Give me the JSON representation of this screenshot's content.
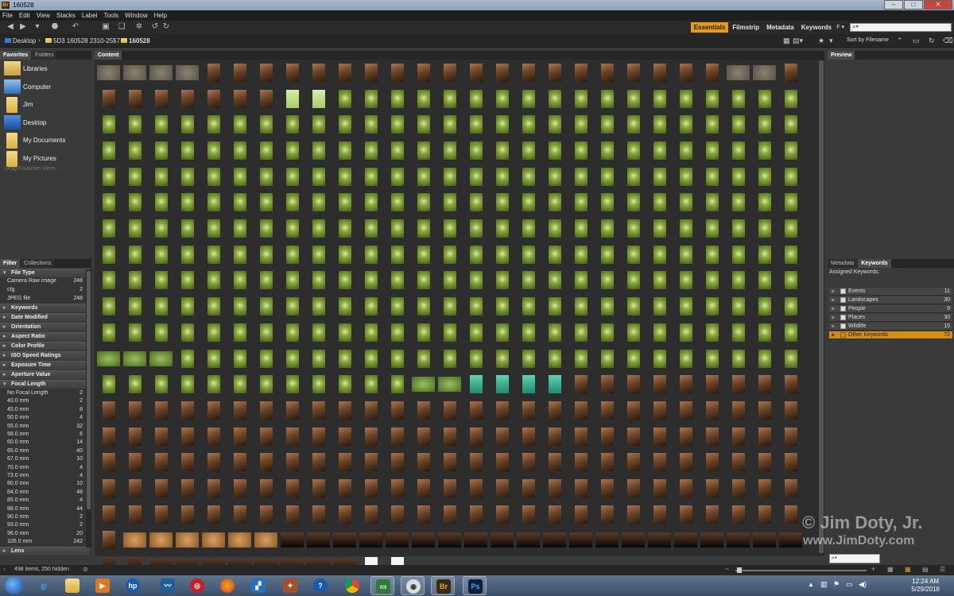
{
  "window": {
    "title": "160528",
    "app_icon": "Br"
  },
  "menu": [
    "File",
    "Edit",
    "View",
    "Stacks",
    "Label",
    "Tools",
    "Window",
    "Help"
  ],
  "workspaces": [
    "Essentials",
    "Filmstrip",
    "Metadata",
    "Keywords"
  ],
  "active_workspace": "Essentials",
  "breadcrumb": [
    "Desktop",
    "5D3 160528 2310-2557",
    "160528"
  ],
  "sort_label": "Sort by Filename",
  "tabs": {
    "favorites": "Favorites",
    "folders": "Folders",
    "content": "Content",
    "preview": "Preview",
    "filter": "Filter",
    "collections": "Collections",
    "metadata": "Metadata",
    "keywords": "Keywords"
  },
  "favorites": [
    "Libraries",
    "Computer",
    "Jim",
    "Desktop",
    "My Documents",
    "My Pictures"
  ],
  "favorites_hint": "Drag Favorites Here...",
  "filter": {
    "file_type_header": "File Type",
    "file_types": [
      {
        "label": "Camera Raw image",
        "count": "248"
      },
      {
        "label": "ctg",
        "count": "2"
      },
      {
        "label": "JPEG file",
        "count": "248"
      }
    ],
    "headers": [
      "Keywords",
      "Date Modified",
      "Orientation",
      "Aspect Ratio",
      "Color Profile",
      "ISO Speed Ratings",
      "Exposure Time",
      "Aperture Value"
    ],
    "focal_header": "Focal Length",
    "focal_lengths": [
      {
        "label": "No Focal Length",
        "count": "2"
      },
      {
        "label": "40.0 mm",
        "count": "2"
      },
      {
        "label": "45.0 mm",
        "count": "8"
      },
      {
        "label": "50.0 mm",
        "count": "4"
      },
      {
        "label": "55.0 mm",
        "count": "32"
      },
      {
        "label": "58.0 mm",
        "count": "6"
      },
      {
        "label": "60.0 mm",
        "count": "14"
      },
      {
        "label": "65.0 mm",
        "count": "40"
      },
      {
        "label": "67.0 mm",
        "count": "10"
      },
      {
        "label": "70.0 mm",
        "count": "4"
      },
      {
        "label": "73.0 mm",
        "count": "4"
      },
      {
        "label": "80.0 mm",
        "count": "10"
      },
      {
        "label": "84.0 mm",
        "count": "48"
      },
      {
        "label": "85.0 mm",
        "count": "4"
      },
      {
        "label": "88.0 mm",
        "count": "44"
      },
      {
        "label": "90.0 mm",
        "count": "2"
      },
      {
        "label": "93.0 mm",
        "count": "2"
      },
      {
        "label": "96.0 mm",
        "count": "20"
      },
      {
        "label": "105.0 mm",
        "count": "242"
      }
    ],
    "lens_header": "Lens"
  },
  "keywords_panel": {
    "assigned_label": "Assigned Keywords:",
    "items": [
      {
        "label": "Events",
        "count": "11"
      },
      {
        "label": "Landscapes",
        "count": "30"
      },
      {
        "label": "People",
        "count": "9"
      },
      {
        "label": "Places",
        "count": "30"
      },
      {
        "label": "Wildlife",
        "count": "15"
      },
      {
        "label": "Other Keywords",
        "count": "72"
      }
    ],
    "selected": "Other Keywords"
  },
  "status": "498 items, 250 hidden",
  "watermark": {
    "line1": "© Jim Doty, Jr.",
    "line2": "www.JimDoty.com"
  },
  "clock": {
    "time": "12:24 AM",
    "date": "5/29/2016"
  },
  "colors": {
    "accent": "#e59b14",
    "foliage": "#6f8a2a",
    "portrait": "#6a4426",
    "panel": "#3a3a3a",
    "content_bg": "#2d2d2d"
  },
  "thumbnail_rows": [
    "GGGGPPPPPPPPPPPPPPPPPPPPPPPPGGGGPP",
    "PPPPPPBBLLLLLLLLLLLLLLLLLLLLLLLLLLL",
    "LLLLLLLLLLLLLLLLLLLLLLLLLLLLL",
    "LLLLLLLLLLLLLLLLLLLLLLLLLLLLL",
    "LLLLLLLLLLLLLLLLLLLLLLLLLLLLL",
    "LLLLLLLLLLLLLLLLLLLLLLLLLLLLL",
    "LLLLLLLLLLLLLLLLLLLLLLLLLLLLL",
    "LLLLLLLLLLLLLLLLLLLLLLLLLLLLL",
    "LLLLLLLLLLLLLLLLLLLLLLLLLLLLL",
    "LLLLLLLLLLLLLLLLLLLLLLLLLLLLL",
    "LLLLLLLLLLLLLLLLLLLLLLLLLLLLL"
  ]
}
